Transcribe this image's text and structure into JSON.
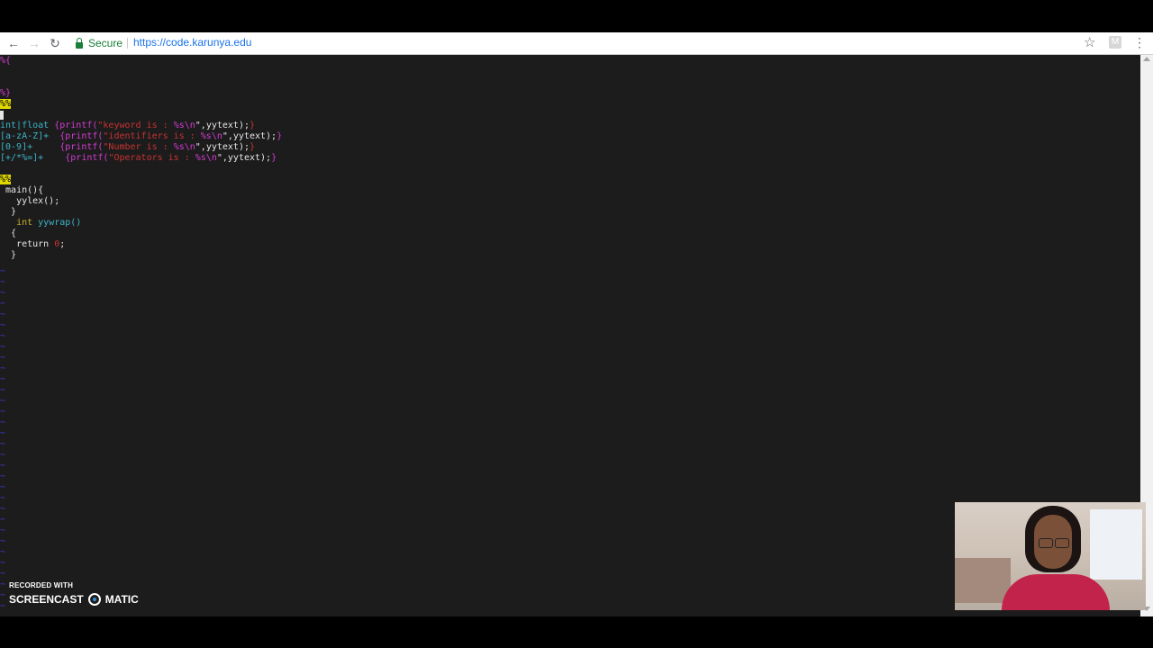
{
  "browser": {
    "secure_label": "Secure",
    "url": "https://code.karunya.edu",
    "extension_label": "M"
  },
  "editor": {
    "lines": {
      "open_defs": "%{",
      "close_defs": "%}",
      "sep1": "%%",
      "rule1_pattern": "int|float",
      "rule1_action_a": "{printf(",
      "rule1_string": "\"keyword is : ",
      "rule1_fmt": "%s\\n",
      "rule1_action_b": "\",yytext);",
      "rule1_brace": "}",
      "rule2_pattern": "[a-zA-Z]+",
      "rule2_action_a": "{printf(",
      "rule2_string": "\"identifiers is : ",
      "rule2_fmt": "%s\\n",
      "rule2_action_b": "\",yytext);",
      "rule2_brace": "}",
      "rule3_pattern": "[0-9]+",
      "rule3_action_a": "{printf(",
      "rule3_string": "\"Number is : ",
      "rule3_fmt": "%s\\n",
      "rule3_action_b": "\",yytext);",
      "rule3_brace": "}",
      "rule4_pattern": "[+/*%=]+",
      "rule4_action_a": "{printf(",
      "rule4_string": "\"Operators is : ",
      "rule4_fmt": "%s\\n",
      "rule4_action_b": "\",yytext);",
      "rule4_brace": "}",
      "sep2": "%%",
      "main": "main(){",
      "yylex": "yylex();",
      "close1": "}",
      "yywrap_type": "int",
      "yywrap_name": "yywrap()",
      "open2": "{",
      "return_kw": "return",
      "return_val": "0",
      "return_semi": ";",
      "close2": "}"
    },
    "tilde": "~"
  },
  "watermark": {
    "small": "RECORDED WITH",
    "brand_a": "SCREENCAST",
    "brand_b": "MATIC"
  },
  "colors": {
    "terminal_bg": "#1c1c1c",
    "preproc": "#d33bd3",
    "pattern": "#3bb4c8",
    "string": "#c83232",
    "search_highlight": "#e0d800",
    "tilde": "#3b3bd3"
  }
}
